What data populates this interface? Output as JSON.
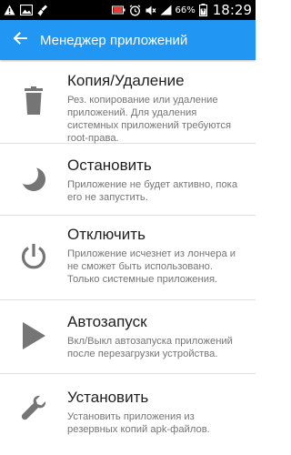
{
  "status_bar": {
    "battery_percent": "66%",
    "time": "18:29",
    "icons": [
      "warning-icon",
      "image-icon",
      "cleaner-icon",
      "battery-charging-icon",
      "alarm-icon",
      "mute-icon",
      "signal-icon",
      "battery-icon"
    ]
  },
  "app_bar": {
    "title": "Менеджер приложений",
    "color": "#2196f3"
  },
  "items": [
    {
      "title": "Копия/Удаление",
      "description": "Рез. копирование или удаление приложений. Для удаления системных приложений требуются root-права.",
      "icon": "trash-icon"
    },
    {
      "title": "Остановить",
      "description": "Приложение не будет активно, пока его не запустить.",
      "icon": "moon-icon"
    },
    {
      "title": "Отключить",
      "description": "Приложение исчезнет из лончера и не сможет быть использовано. Только системные приложения.",
      "icon": "power-icon"
    },
    {
      "title": "Автозапуск",
      "description": "Вкл/Выкл автозапуска приложений после перезагрузки устройства.",
      "icon": "play-icon"
    },
    {
      "title": "Установить",
      "description": "Установить приложения из резервных копий apk-файлов.",
      "icon": "wrench-icon"
    }
  ]
}
